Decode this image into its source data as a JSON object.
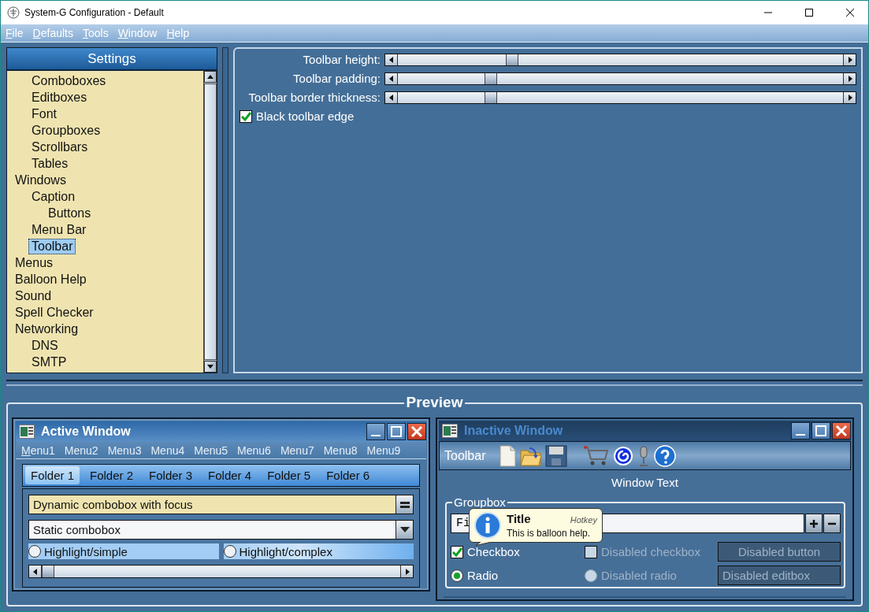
{
  "window": {
    "title": "System-G Configuration - Default"
  },
  "menu_bar": [
    {
      "label": "File",
      "mnemonic": true
    },
    {
      "label": "Defaults",
      "mnemonic": true
    },
    {
      "label": "Tools",
      "mnemonic": true
    },
    {
      "label": "Window",
      "mnemonic": true
    },
    {
      "label": "Help",
      "mnemonic": true
    }
  ],
  "settings": {
    "title": "Settings",
    "scrolled_children": [
      {
        "label": "Comboboxes",
        "selected": false
      },
      {
        "label": "Editboxes",
        "selected": false
      },
      {
        "label": "Font",
        "selected": false
      },
      {
        "label": "Groupboxes",
        "selected": false
      },
      {
        "label": "Scrollbars",
        "selected": false
      },
      {
        "label": "Tables",
        "selected": false
      }
    ],
    "items": [
      {
        "label": "Windows",
        "selected": false,
        "children": [
          {
            "label": "Caption",
            "selected": false,
            "children": [
              {
                "label": "Buttons",
                "selected": false
              }
            ]
          },
          {
            "label": "Menu Bar",
            "selected": false
          },
          {
            "label": "Toolbar",
            "selected": true
          }
        ]
      },
      {
        "label": "Menus",
        "selected": false
      },
      {
        "label": "Balloon Help",
        "selected": false
      },
      {
        "label": "Sound",
        "selected": false
      },
      {
        "label": "Spell Checker",
        "selected": false
      },
      {
        "label": "Networking",
        "selected": false,
        "children": [
          {
            "label": "DNS",
            "selected": false
          },
          {
            "label": "SMTP",
            "selected": false
          }
        ]
      }
    ]
  },
  "options": {
    "sliders": [
      {
        "label": "Toolbar height:",
        "level": 0.25
      },
      {
        "label": "Toolbar padding:",
        "level": 0.2
      },
      {
        "label": "Toolbar border thickness:",
        "level": 0.2
      }
    ],
    "checkbox": {
      "label": "Black toolbar edge",
      "checked": true
    }
  },
  "preview": {
    "title": "Preview",
    "active_window": {
      "title": "Active Window",
      "menus": [
        {
          "label": "Menu1",
          "mnemonic": true
        },
        {
          "label": "Menu2",
          "mnemonic": false
        },
        {
          "label": "Menu3",
          "mnemonic": false
        },
        {
          "label": "Menu4",
          "mnemonic": false
        },
        {
          "label": "Menu5",
          "mnemonic": false
        },
        {
          "label": "Menu6",
          "mnemonic": false
        },
        {
          "label": "Menu7",
          "mnemonic": false
        },
        {
          "label": "Menu8",
          "mnemonic": false
        },
        {
          "label": "Menu9",
          "mnemonic": false
        }
      ],
      "tabs": [
        {
          "label": "Folder 1",
          "selected": true
        },
        {
          "label": "Folder 2",
          "selected": false
        },
        {
          "label": "Folder 3",
          "selected": false
        },
        {
          "label": "Folder 4",
          "selected": false
        },
        {
          "label": "Folder 5",
          "selected": false
        },
        {
          "label": "Folder 6",
          "selected": false
        }
      ],
      "combos": [
        {
          "kind": "dynamic",
          "value": "Dynamic combobox with focus",
          "focused": true
        },
        {
          "kind": "static",
          "value": "Static combobox",
          "focused": false
        }
      ],
      "radios": [
        {
          "kind": "simple",
          "label": "Highlight/simple",
          "checked": false
        },
        {
          "kind": "complex",
          "label": "Highlight/complex",
          "checked": false
        }
      ],
      "slider": {
        "level": 0
      }
    },
    "inactive_window": {
      "title": "Inactive Window",
      "toolbar_label": "Toolbar",
      "window_text": "Window Text",
      "groupbox": {
        "label": "Groupbox",
        "field_value": "Fi",
        "controls": [
          {
            "kind": "checkbox",
            "label": "Checkbox",
            "checked": true,
            "disabled": false
          },
          {
            "kind": "checkbox",
            "label": "Disabled checkbox",
            "checked": false,
            "disabled": true
          },
          {
            "kind": "button",
            "label": "Disabled button",
            "disabled": true
          },
          {
            "kind": "radio",
            "label": "Radio",
            "checked": true,
            "disabled": false
          },
          {
            "kind": "radio",
            "label": "Disabled radio",
            "checked": false,
            "disabled": true
          },
          {
            "kind": "editbox",
            "value": "Disabled editbox",
            "disabled": true
          }
        ]
      },
      "balloon": {
        "title": "Title",
        "hotkey": "Hotkey",
        "text": "This is balloon help."
      }
    }
  }
}
